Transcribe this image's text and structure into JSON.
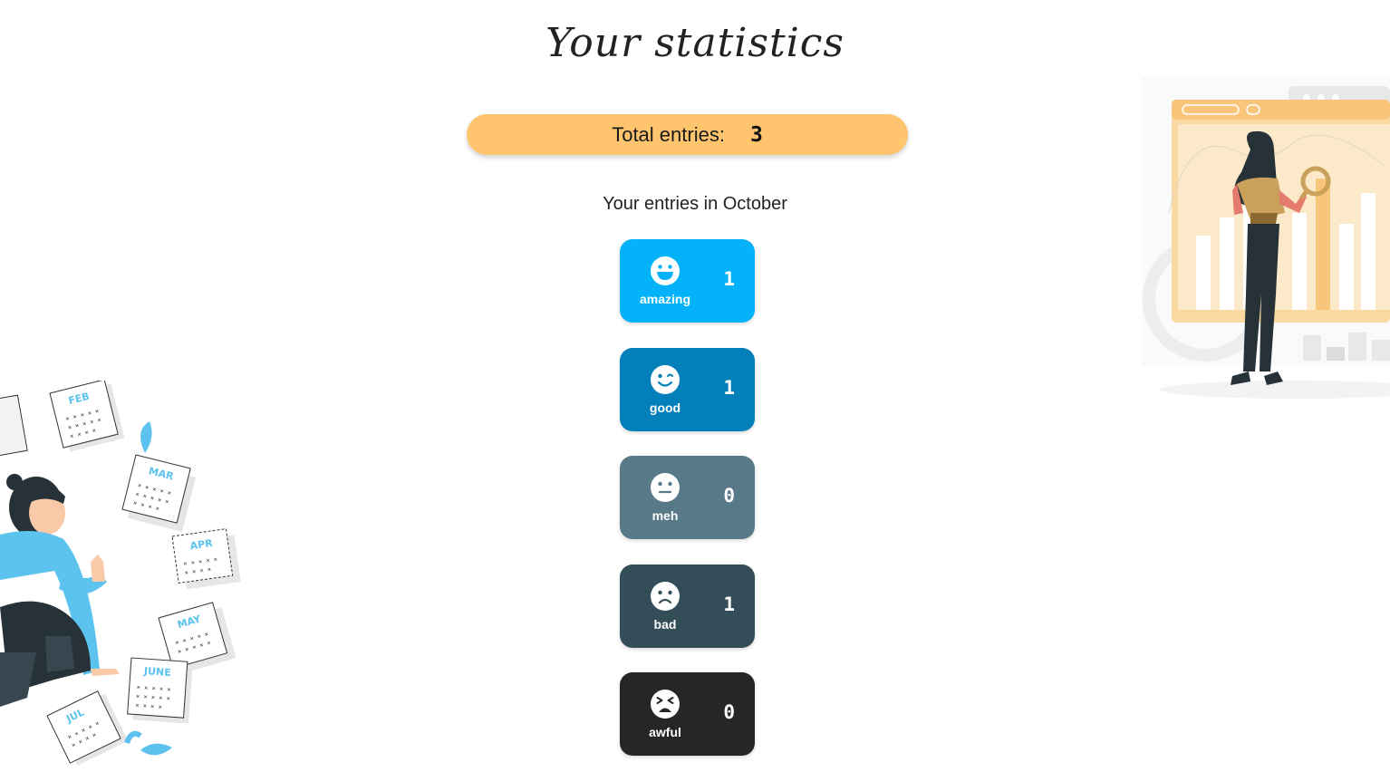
{
  "page": {
    "title": "Your statistics",
    "total_label": "Total entries:",
    "total_value": "3",
    "month_heading": "Your entries in October"
  },
  "colors": {
    "total_bar": "#ffc46e",
    "amazing": "#03b2f8",
    "good": "#0380ba",
    "meh": "#587987",
    "bad": "#334d59",
    "awful": "#262626"
  },
  "moods": [
    {
      "label": "amazing",
      "count": "1",
      "icon": "grinning-face-icon",
      "color": "#03b2f8"
    },
    {
      "label": "good",
      "count": "1",
      "icon": "winking-face-icon",
      "color": "#0380ba"
    },
    {
      "label": "meh",
      "count": "0",
      "icon": "neutral-face-icon",
      "color": "#587987"
    },
    {
      "label": "bad",
      "count": "1",
      "icon": "frowning-face-icon",
      "color": "#334d59"
    },
    {
      "label": "awful",
      "count": "0",
      "icon": "tired-face-icon",
      "color": "#262626"
    }
  ],
  "illustration": {
    "calendar_months": [
      "FEB",
      "MAR",
      "APR",
      "MAY",
      "JUNE",
      "JUL"
    ]
  }
}
